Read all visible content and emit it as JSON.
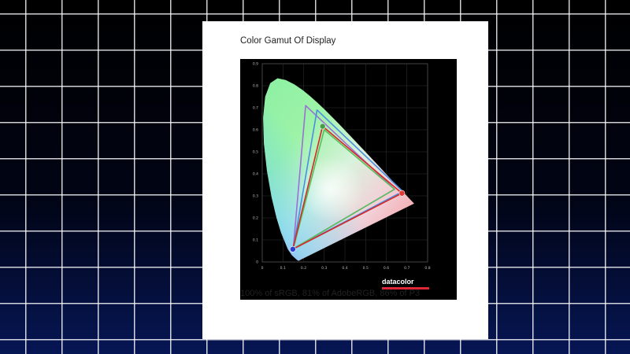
{
  "panel": {
    "title": "Color Gamut Of Display",
    "caption": "100% of sRGB, 81% of AdobeRGB, 86% of P3"
  },
  "logo": {
    "text": "datacolor",
    "accent_color": "#e0273a"
  },
  "colors": {
    "background_top": "#000000",
    "background_bottom": "#061654",
    "grid_lines": "#ffffff",
    "plot_background": "#000000",
    "display_gamut": "#d62828",
    "srgb_gamut": "#59c05c",
    "adobergb_gamut": "#9b6fd6",
    "p3_gamut": "#4a8fe0"
  },
  "chart_data": {
    "type": "scatter",
    "title": "",
    "xlabel": "",
    "ylabel": "",
    "xlim": [
      0,
      0.8
    ],
    "ylim": [
      0,
      0.9
    ],
    "x_ticks": [
      "0",
      "0.1",
      "0.2",
      "0.3",
      "0.4",
      "0.5",
      "0.6",
      "0.7",
      "0.8"
    ],
    "y_ticks": [
      "0",
      "0.1",
      "0.2",
      "0.3",
      "0.4",
      "0.5",
      "0.6",
      "0.7",
      "0.8",
      "0.9"
    ],
    "grid": true,
    "spectral_locus": [
      [
        0.175,
        0.005
      ],
      [
        0.165,
        0.012
      ],
      [
        0.144,
        0.03
      ],
      [
        0.124,
        0.058
      ],
      [
        0.091,
        0.133
      ],
      [
        0.069,
        0.201
      ],
      [
        0.045,
        0.295
      ],
      [
        0.023,
        0.413
      ],
      [
        0.008,
        0.538
      ],
      [
        0.004,
        0.655
      ],
      [
        0.014,
        0.75
      ],
      [
        0.039,
        0.812
      ],
      [
        0.074,
        0.834
      ],
      [
        0.114,
        0.826
      ],
      [
        0.155,
        0.806
      ],
      [
        0.193,
        0.782
      ],
      [
        0.23,
        0.754
      ],
      [
        0.266,
        0.724
      ],
      [
        0.302,
        0.692
      ],
      [
        0.337,
        0.659
      ],
      [
        0.373,
        0.625
      ],
      [
        0.408,
        0.59
      ],
      [
        0.444,
        0.555
      ],
      [
        0.479,
        0.52
      ],
      [
        0.513,
        0.486
      ],
      [
        0.547,
        0.452
      ],
      [
        0.579,
        0.42
      ],
      [
        0.608,
        0.39
      ],
      [
        0.658,
        0.341
      ],
      [
        0.735,
        0.265
      ]
    ],
    "gamuts": [
      {
        "key": "adobergb",
        "points": [
          [
            0.64,
            0.33
          ],
          [
            0.21,
            0.71
          ],
          [
            0.15,
            0.06
          ]
        ],
        "color": "#9b6fd6"
      },
      {
        "key": "p3",
        "points": [
          [
            0.68,
            0.32
          ],
          [
            0.265,
            0.69
          ],
          [
            0.15,
            0.06
          ]
        ],
        "color": "#4a8fe0"
      },
      {
        "key": "srgb",
        "points": [
          [
            0.64,
            0.33
          ],
          [
            0.3,
            0.6
          ],
          [
            0.15,
            0.06
          ]
        ],
        "color": "#59c05c"
      },
      {
        "key": "display",
        "points": [
          [
            0.676,
            0.312
          ],
          [
            0.292,
            0.616
          ],
          [
            0.148,
            0.058
          ]
        ],
        "color": "#d62828"
      }
    ],
    "primaries": [
      {
        "label": "red",
        "x": 0.676,
        "y": 0.312,
        "color": "#e53935"
      },
      {
        "label": "green",
        "x": 0.292,
        "y": 0.616,
        "color": "#43a047"
      },
      {
        "label": "blue",
        "x": 0.148,
        "y": 0.058,
        "color": "#2c3fd4"
      }
    ]
  }
}
